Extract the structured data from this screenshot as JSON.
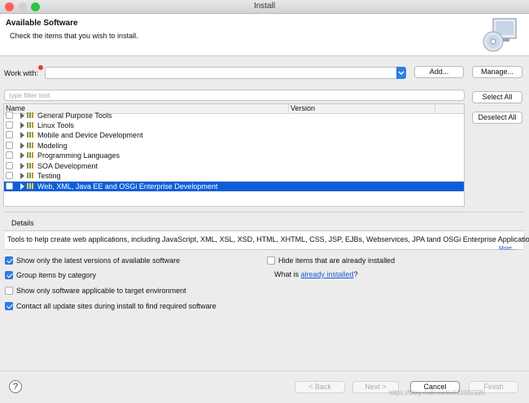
{
  "window": {
    "title": "Install"
  },
  "header": {
    "title": "Available Software",
    "subtitle": "Check the items that you wish to install."
  },
  "work_with": {
    "label": "Work with:",
    "value": "",
    "add_label": "Add...",
    "manage_label": "Manage..."
  },
  "filter": {
    "placeholder": "type filter text"
  },
  "buttons": {
    "select_all": "Select All",
    "deselect_all": "Deselect All"
  },
  "tree": {
    "columns": [
      "Name",
      "Version"
    ],
    "rows": [
      {
        "label": "General Purpose Tools",
        "checked": false,
        "selected": false
      },
      {
        "label": "Linux Tools",
        "checked": false,
        "selected": false
      },
      {
        "label": "Mobile and Device Development",
        "checked": false,
        "selected": false
      },
      {
        "label": "Modeling",
        "checked": false,
        "selected": false
      },
      {
        "label": "Programming Languages",
        "checked": false,
        "selected": false
      },
      {
        "label": "SOA Development",
        "checked": false,
        "selected": false
      },
      {
        "label": "Testing",
        "checked": false,
        "selected": false
      },
      {
        "label": "Web, XML, Java EE and OSGi Enterprise Development",
        "checked": false,
        "selected": true
      }
    ]
  },
  "details": {
    "label": "Details",
    "text": "Tools to help create web applications, including JavaScript, XML, XSL, XSD, HTML, XHTML, CSS, JSP, EJBs, Webservices, JPA tand OSGi Enterprise Applications",
    "more": "More..."
  },
  "options": {
    "latest_versions": {
      "label": "Show only the latest versions of available software",
      "checked": true
    },
    "group_by_category": {
      "label": "Group items by category",
      "checked": true
    },
    "target_env": {
      "label": "Show only software applicable to target environment",
      "checked": false
    },
    "contact_sites": {
      "label": "Contact all update sites during install to find required software",
      "checked": true
    },
    "hide_installed": {
      "label": "Hide items that are already installed",
      "checked": false
    }
  },
  "already_installed": {
    "prefix": "What is ",
    "link": "already installed",
    "suffix": "?"
  },
  "footer": {
    "help": "?",
    "back": "< Back",
    "next": "Next >",
    "cancel": "Cancel",
    "finish": "Finish"
  },
  "watermark": "https://blog.csdn.net/u011662320",
  "colors": {
    "selection": "#0f5ed8",
    "accent": "#2f7fe6",
    "link": "#1a5bd9"
  }
}
